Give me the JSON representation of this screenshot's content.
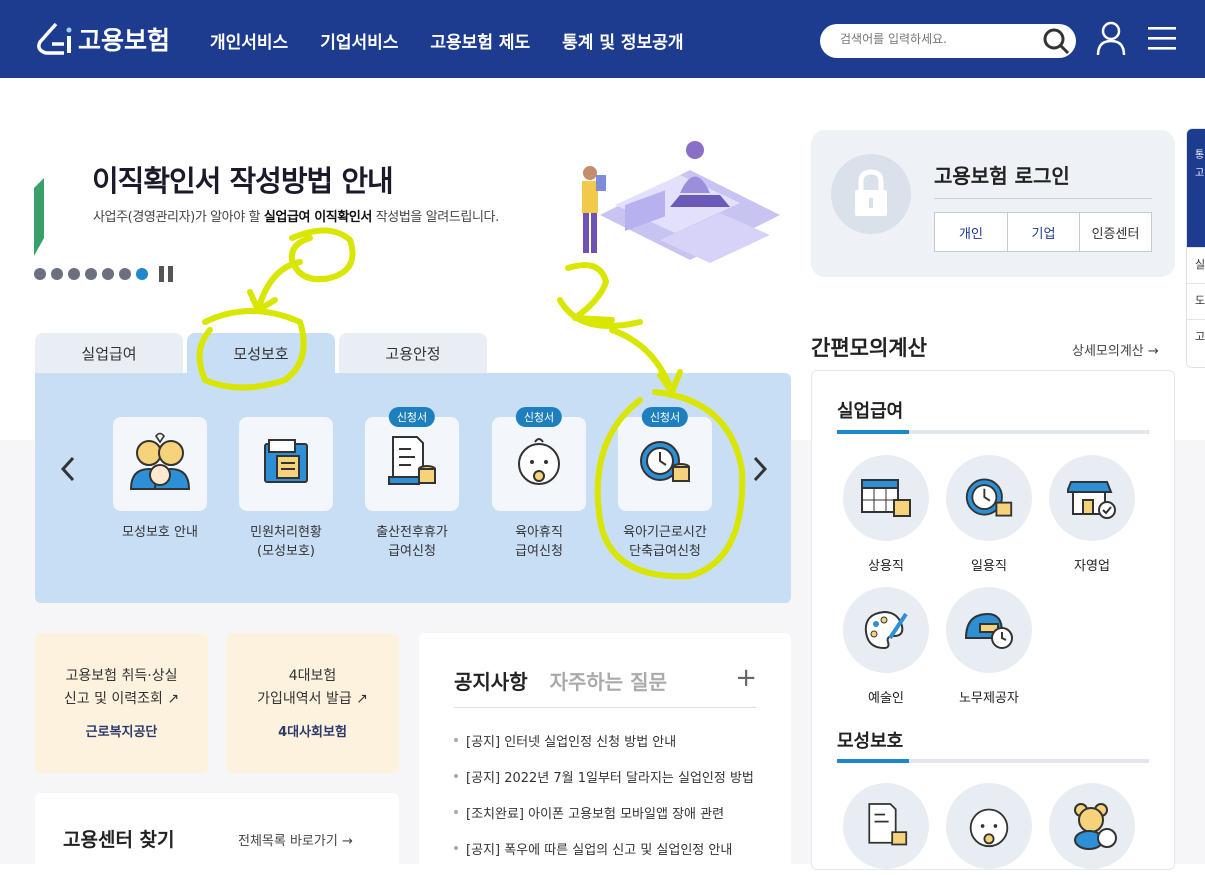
{
  "header": {
    "logo_text": "고용보험",
    "nav": [
      "개인서비스",
      "기업서비스",
      "고용보험 제도",
      "통계 및 정보공개"
    ],
    "search_placeholder": "검색어를 입력하세요."
  },
  "banner": {
    "title": "이직확인서 작성방법 안내",
    "subtitle_pre": "사업주(경영관리자)가 알아야 할 ",
    "subtitle_b1": "실업급여 이직확인서",
    "subtitle_post": " 작성법을 알려드립니다."
  },
  "tabs": [
    "실업급여",
    "모성보호",
    "고용안정"
  ],
  "services": [
    {
      "label": "모성보호 안내",
      "badge": ""
    },
    {
      "label": "민원처리현황\n(모성보호)",
      "badge": ""
    },
    {
      "label": "출산전후휴가\n급여신청",
      "badge": "신청서"
    },
    {
      "label": "육아휴직\n급여신청",
      "badge": "신청서"
    },
    {
      "label": "육아기근로시간\n단축급여신청",
      "badge": "신청서"
    }
  ],
  "quick_cards": [
    {
      "text": "고용보험 취득·상실\n신고 및 이력조회 ↗",
      "org": "근로복지공단"
    },
    {
      "text": "4대보험\n가입내역서 발급 ↗",
      "org": "4대사회보험"
    }
  ],
  "center": {
    "title": "고용센터 찾기",
    "more": "전체목록 바로가기 →"
  },
  "notice": {
    "tab_active": "공지사항",
    "tab_inactive": "자주하는 질문",
    "items": [
      "[공지] 인터넷 실업인정 신청 방법 안내",
      "[공지] 2022년 7월 1일부터 달라지는 실업인정 방법",
      "[조치완료] 아이폰 고용보험 모바일앱 장애 관련",
      "[공지] 폭우에 따른 실업의 신고 및 실업인정 안내"
    ]
  },
  "login": {
    "title": "고용보험 로그인",
    "buttons": [
      "개인",
      "기업",
      "인증센터"
    ]
  },
  "calc": {
    "title": "간편모의계산",
    "more": "상세모의계산 →",
    "sec1": "실업급여",
    "items1": [
      "상용직",
      "일용직",
      "자영업",
      "예술인",
      "노무제공자"
    ],
    "sec2": "모성보호"
  },
  "side": {
    "top": "통 고",
    "rows": [
      "실",
      "도",
      "고"
    ]
  },
  "annotations": {
    "one": "1",
    "two": "2"
  },
  "colors": {
    "header": "#1d3c8f",
    "accent": "#1e88c8",
    "highlight": "#d8e600"
  }
}
